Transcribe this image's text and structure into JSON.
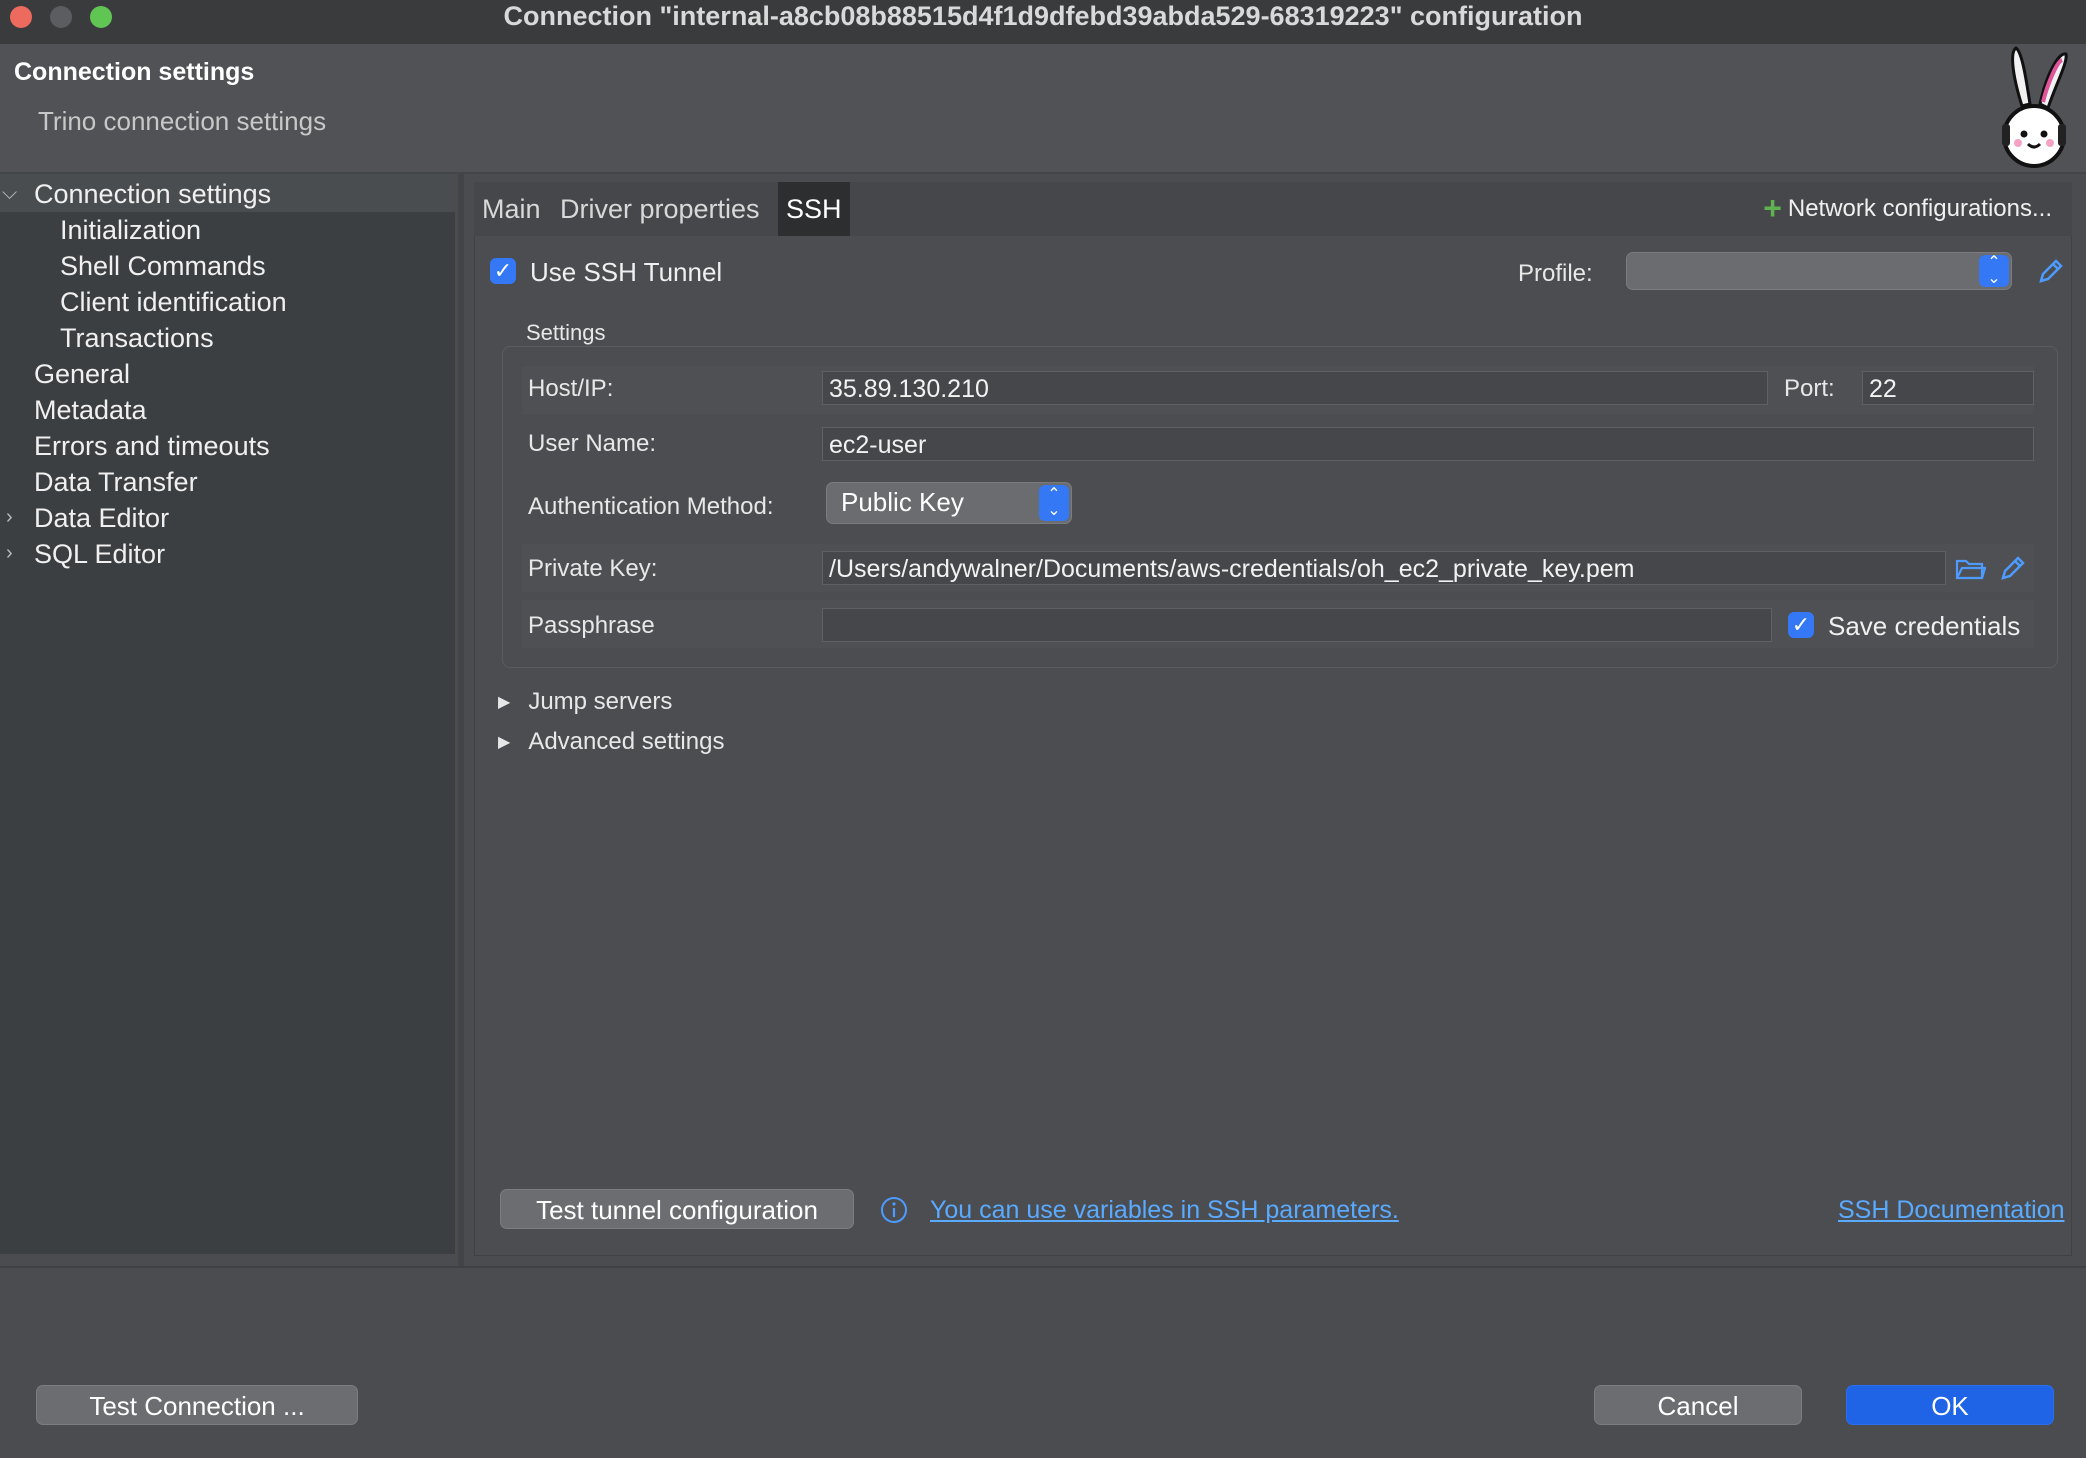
{
  "window": {
    "title": "Connection \"internal-a8cb08b88515d4f1d9dfebd39abda529-68319223\" configuration"
  },
  "header": {
    "title": "Connection settings",
    "subtitle": "Trino connection settings",
    "mascot_icon": "bunny-mascot-icon"
  },
  "sidebar": {
    "items": [
      {
        "label": "Connection settings",
        "expanded": true,
        "selected": true
      },
      {
        "label": "Initialization"
      },
      {
        "label": "Shell Commands"
      },
      {
        "label": "Client identification"
      },
      {
        "label": "Transactions"
      },
      {
        "label": "General"
      },
      {
        "label": "Metadata"
      },
      {
        "label": "Errors and timeouts"
      },
      {
        "label": "Data Transfer"
      },
      {
        "label": "Data Editor",
        "collapsed": true
      },
      {
        "label": "SQL Editor",
        "collapsed": true
      }
    ]
  },
  "tabs": [
    {
      "label": "Main"
    },
    {
      "label": "Driver properties"
    },
    {
      "label": "SSH",
      "active": true
    }
  ],
  "network_configs_label": "Network configurations...",
  "ssh": {
    "use_tunnel_label": "Use SSH Tunnel",
    "use_tunnel_checked": true,
    "profile_label": "Profile:",
    "profile_value": "",
    "settings_label": "Settings",
    "host_label": "Host/IP:",
    "host_value": "35.89.130.210",
    "port_label": "Port:",
    "port_value": "22",
    "username_label": "User Name:",
    "username_value": "ec2-user",
    "auth_label": "Authentication Method:",
    "auth_value": "Public Key",
    "private_key_label": "Private Key:",
    "private_key_value": "/Users/andywalner/Documents/aws-credentials/oh_ec2_private_key.pem",
    "passphrase_label": "Passphrase",
    "passphrase_value": "",
    "save_credentials_label": "Save credentials",
    "save_credentials_checked": true,
    "jump_servers_label": "Jump servers",
    "advanced_label": "Advanced settings",
    "test_tunnel_label": "Test tunnel configuration",
    "variables_link": "You can use variables in SSH parameters.",
    "docs_link": "SSH Documentation"
  },
  "footer": {
    "test_connection_label": "Test Connection ...",
    "cancel_label": "Cancel",
    "ok_label": "OK"
  },
  "colors": {
    "accent": "#3478f6",
    "ok_button": "#1f63e6",
    "link": "#5aaaff",
    "plus_icon": "#5fb24f"
  }
}
